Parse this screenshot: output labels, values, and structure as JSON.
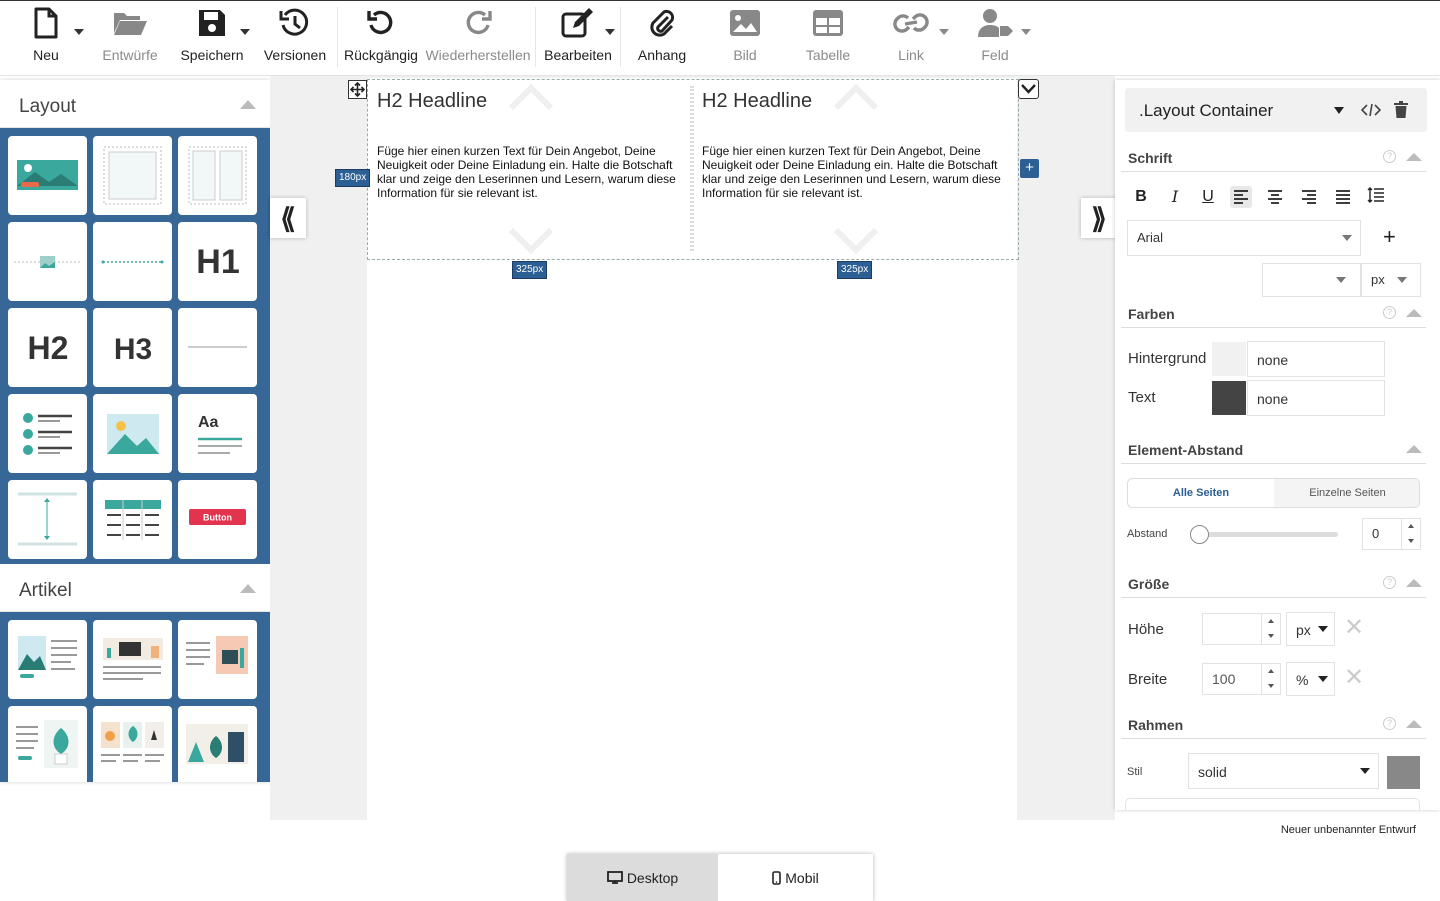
{
  "toolbar": {
    "new": "Neu",
    "drafts": "Entwürfe",
    "save": "Speichern",
    "versions": "Versionen",
    "undo": "Rückgängig",
    "redo": "Wiederherstellen",
    "edit": "Bearbeiten",
    "attachment": "Anhang",
    "image": "Bild",
    "table": "Tabelle",
    "link": "Link",
    "field": "Feld"
  },
  "left_panel": {
    "layout_title": "Layout",
    "article_title": "Artikel",
    "layout_tiles": [
      "image-text-block",
      "box-container",
      "two-column-container",
      "image-divider",
      "line-divider",
      "H1",
      "H2",
      "H3",
      "horizontal-rule",
      "checklist",
      "image",
      "text",
      "spacer",
      "table",
      "Button"
    ],
    "tile_text": {
      "h1": "H1",
      "h2": "H2",
      "h3": "H3",
      "aa": "Aa",
      "button": "Button"
    }
  },
  "canvas": {
    "columns": [
      {
        "headline": "H2 Headline",
        "text": "Füge hier einen kurzen Text für Dein Angebot, Deine Neuigkeit oder Deine Einladung ein. Halte die Botschaft klar und zeige den Leserinnen und Lesern, warum diese Information für sie relevant ist.",
        "width_badge": "325px"
      },
      {
        "headline": "H2 Headline",
        "text": "Füge hier einen kurzen Text für Dein Angebot, Deine Neuigkeit oder Deine Einladung ein. Halte die Botschaft klar und zeige den Leserinnen und Lesern, warum diese Information für sie relevant ist.",
        "width_badge": "325px"
      }
    ],
    "height_badge": "180px"
  },
  "right_panel": {
    "element_select": ".Layout Container",
    "font_section": "Schrift",
    "font_family": "Arial",
    "font_size": "",
    "font_unit": "px",
    "colors_section": "Farben",
    "background_label": "Hintergrund",
    "background_value": "none",
    "text_label": "Text",
    "text_value": "none",
    "text_swatch": "#444444",
    "background_swatch": "#f1f1f1",
    "spacing_section": "Element-Abstand",
    "all_sides": "Alle Seiten",
    "single_sides": "Einzelne Seiten",
    "spacing_label": "Abstand",
    "spacing_value": "0",
    "spacing_level": 0,
    "size_section": "Größe",
    "height_label": "Höhe",
    "height_value": "",
    "height_unit": "px",
    "width_label": "Breite",
    "width_value": "100",
    "width_unit": "%",
    "border_section": "Rahmen",
    "style_label": "Stil",
    "style_value": "solid",
    "border_swatch": "#888888"
  },
  "status": "Neuer unbenannter Entwurf",
  "device": {
    "desktop": "Desktop",
    "mobile": "Mobil"
  },
  "colors": {
    "accent": "#2c5f93",
    "teal": "#3aa89c",
    "panel_blue": "#366796"
  }
}
